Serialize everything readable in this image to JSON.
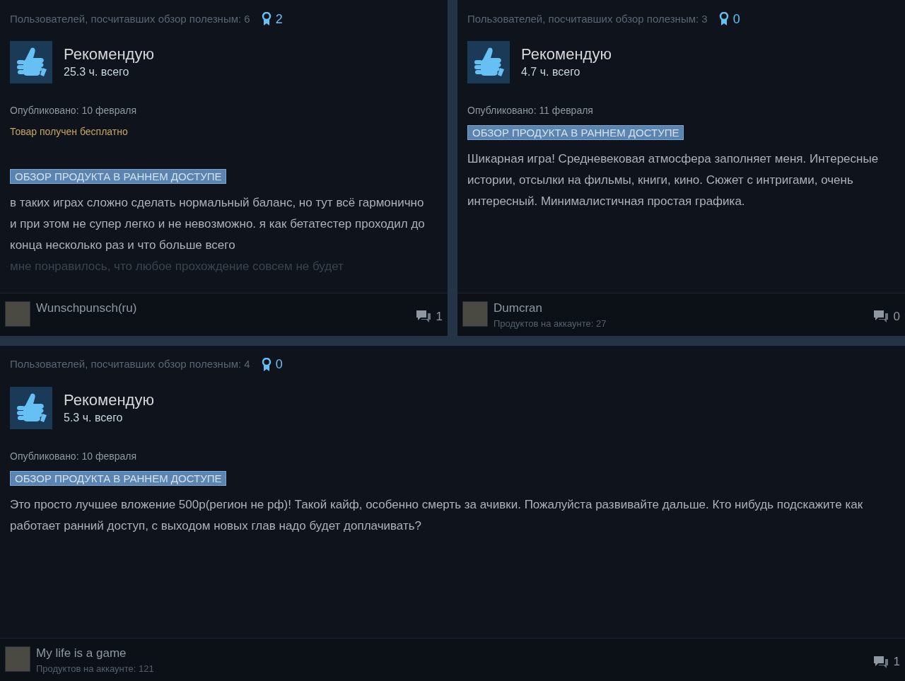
{
  "rows": [
    {
      "reviews": [
        {
          "helpful": "Пользователей, посчитавших обзор полезным: 6",
          "awards": "2",
          "verdict": "Рекомендую",
          "hours": "25.3 ч. всего",
          "posted": "Опубликовано: 10 февраля",
          "free_note": "Товар получен бесплатно",
          "badge": "ОБЗОР ПРОДУКТА В РАННЕМ ДОСТУПЕ",
          "body": "в таких играх сложно сделать нормальный баланс, но тут всё гармонично и при этом не супер легко и не невозможно. я как бетатестер проходил до конца несколько раз и что больше всего",
          "body_faded": "мне понравилось, что любое прохождение совсем не будет",
          "author": "Wunschpunsch(ru)",
          "comments": "1"
        },
        {
          "helpful": "Пользователей, посчитавших обзор полезным: 3",
          "awards": "0",
          "verdict": "Рекомендую",
          "hours": "4.7 ч. всего",
          "posted": "Опубликовано: 11 февраля",
          "badge": "ОБЗОР ПРОДУКТА В РАННЕМ ДОСТУПЕ",
          "body": "Шикарная игра! Средневековая атмосфера заполняет меня. Интересные истории, отсылки на фильмы, книги, кино. Сюжет с интригами, очень интересный. Минималистичная простая графика.",
          "author": "Dumcran",
          "products": "Продуктов на аккаунте: 27",
          "comments": "0"
        }
      ]
    },
    {
      "reviews": [
        {
          "helpful": "Пользователей, посчитавших обзор полезным: 4",
          "awards": "0",
          "verdict": "Рекомендую",
          "hours": "5.3 ч. всего",
          "posted": "Опубликовано: 10 февраля",
          "badge": "ОБЗОР ПРОДУКТА В РАННЕМ ДОСТУПЕ",
          "body": "Это просто лучшее вложение 500р(регион не рф)! Такой кайф, особенно смерть за ачивки. Пожалуйста развивайте дальше. Кто нибудь подскажите как работает ранний доступ, с выходом новых глав надо будет доплачивать?",
          "author": "My life is a game",
          "products": "Продуктов на аккаунте: 121",
          "comments": "1"
        }
      ]
    }
  ]
}
